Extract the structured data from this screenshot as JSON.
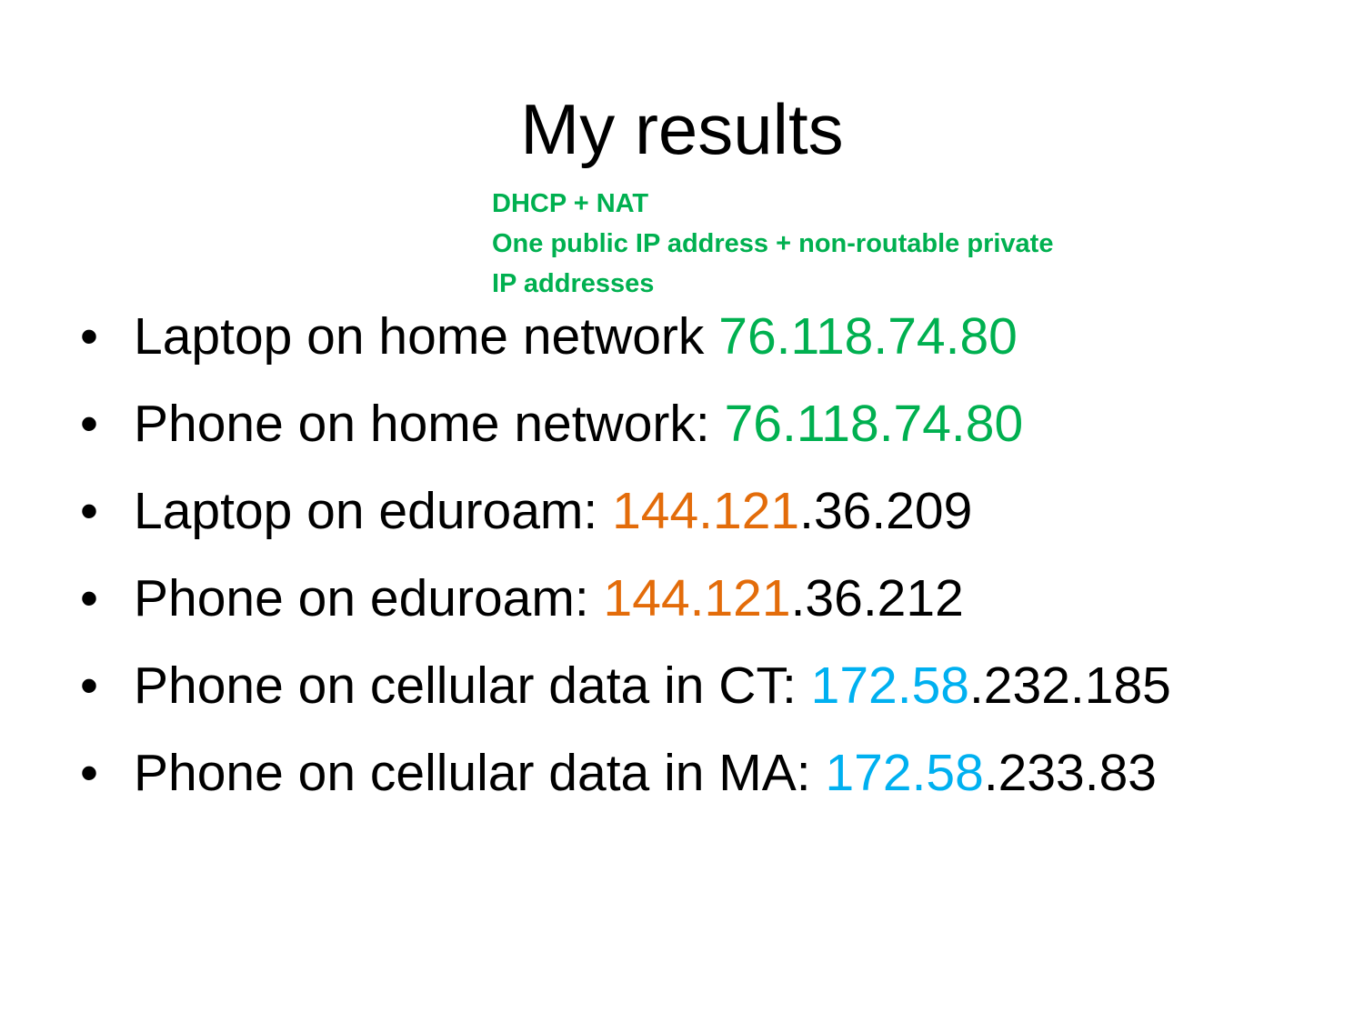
{
  "colors": {
    "green": "#00B050",
    "orange": "#E36C0A",
    "blue": "#00B0F0",
    "black": "#000000"
  },
  "title": "My results",
  "note": {
    "lines": [
      "DHCP + NAT",
      "One public IP address + non-routable private",
      "IP addresses"
    ],
    "color": "#00B050"
  },
  "bullet_symbol": "•",
  "bullets": [
    {
      "label": "Laptop on home network ",
      "highlight": "76.118.74.80",
      "highlight_color": "#00B050",
      "rest": ""
    },
    {
      "label": "Phone on home network: ",
      "highlight": "76.118.74.80",
      "highlight_color": "#00B050",
      "rest": ""
    },
    {
      "label": "Laptop on eduroam: ",
      "highlight": "144.121",
      "highlight_color": "#E36C0A",
      "rest": ".36.209"
    },
    {
      "label": "Phone on eduroam: ",
      "highlight": "144.121",
      "highlight_color": "#E36C0A",
      "rest": ".36.212"
    },
    {
      "label": "Phone on cellular data in CT: ",
      "highlight": "172.58",
      "highlight_color": "#00B0F0",
      "rest": ".232.185"
    },
    {
      "label": "Phone on cellular data in MA: ",
      "highlight": "172.58",
      "highlight_color": "#00B0F0",
      "rest": ".233.83"
    }
  ]
}
